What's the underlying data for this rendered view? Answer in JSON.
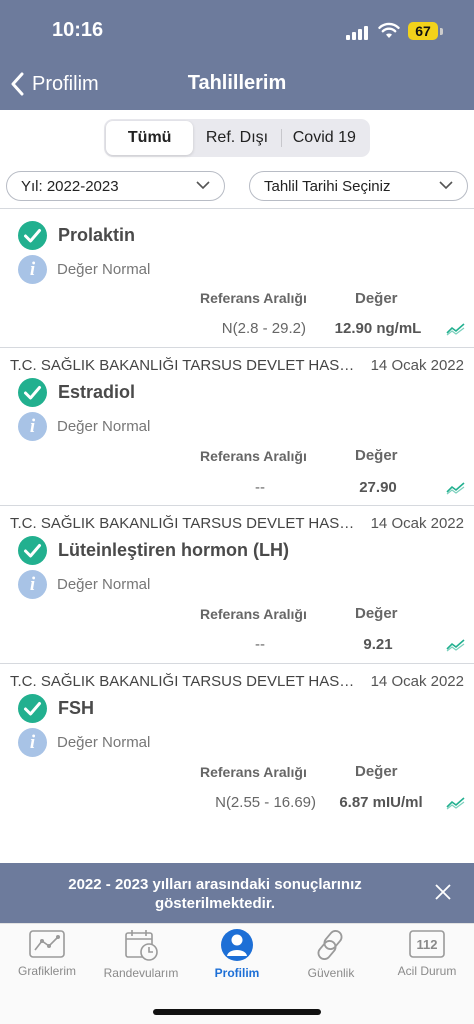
{
  "status_bar": {
    "time": "10:16",
    "battery": "67"
  },
  "header": {
    "back_label": "Profilim",
    "title": "Tahlillerim"
  },
  "segments": [
    {
      "label": "Tümü",
      "active": true
    },
    {
      "label": "Ref. Dışı",
      "active": false
    },
    {
      "label": "Covid 19",
      "active": false
    }
  ],
  "filters": {
    "year": "Yıl: 2022-2023",
    "date": "Tahlil Tarihi Seçiniz"
  },
  "results": [
    {
      "hospital": "",
      "date": "",
      "name": "Prolaktin",
      "status": "Değer Normal",
      "ref_header": "Referans Aralığı",
      "value_header": "Değer",
      "ref_range": "N(2.8 - 29.2)",
      "value": "12.90 ng/mL"
    },
    {
      "hospital": "T.C. SAĞLIK BAKANLIĞI TARSUS DEVLET HASTANESİ",
      "date": "14 Ocak 2022",
      "name": "Estradiol",
      "status": "Değer Normal",
      "ref_header": "Referans Aralığı",
      "value_header": "Değer",
      "ref_range": "--",
      "value": "27.90"
    },
    {
      "hospital": "T.C. SAĞLIK BAKANLIĞI TARSUS DEVLET HASTANESİ",
      "date": "14 Ocak 2022",
      "name": "Lüteinleştiren hormon (LH)",
      "status": "Değer Normal",
      "ref_header": "Referans Aralığı",
      "value_header": "Değer",
      "ref_range": "--",
      "value": "9.21"
    },
    {
      "hospital": "T.C. SAĞLIK BAKANLIĞI TARSUS DEVLET HASTANESİ",
      "date": "14 Ocak 2022",
      "name": "FSH",
      "status": "Değer Normal",
      "ref_header": "Referans Aralığı",
      "value_header": "Değer",
      "ref_range": "N(2.55 - 16.69)",
      "value": "6.87 mIU/ml"
    }
  ],
  "toast": {
    "line1": "2022 - 2023 yılları arasındaki sonuçlarınız",
    "line2": "gösterilmektedir."
  },
  "tabs": [
    {
      "label": "Grafiklerim",
      "icon": "chart-icon",
      "active": false
    },
    {
      "label": "Randevularım",
      "icon": "calendar-clock-icon",
      "active": false
    },
    {
      "label": "Profilim",
      "icon": "profile-icon",
      "active": true
    },
    {
      "label": "Güvenlik",
      "icon": "link-icon",
      "active": false
    },
    {
      "label": "Acil Durum",
      "icon": "emergency-112-icon",
      "active": false,
      "badge": "112"
    }
  ],
  "colors": {
    "header": "#6d7b9c",
    "accent": "#1d6fd6",
    "success": "#22b08f",
    "info": "#a8c3e6",
    "trend": "#22b08f"
  }
}
